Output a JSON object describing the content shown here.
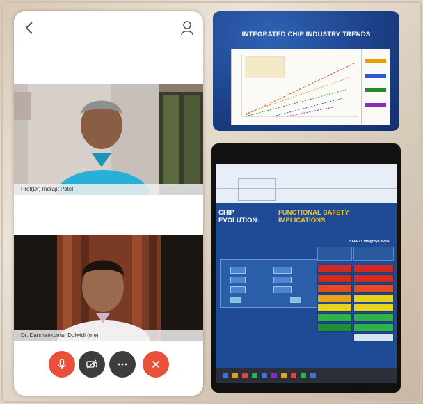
{
  "participants": [
    {
      "name": "Prof(Dr) Indrajit Patel"
    },
    {
      "name": "Dr. Darshankumar Dulwidi (me)"
    }
  ],
  "controls": {
    "mic": "microphone-button",
    "camera": "camera-button",
    "more": "more-options-button",
    "end": "end-call-button"
  },
  "slide_top": {
    "title": "INTEGRATED CHIP INDUSTRY TRENDS"
  },
  "slide_bottom": {
    "title_part1": "CHIP EVOLUTION:",
    "title_part2": "FUNCTIONAL SAFETY IMPLICATIONS",
    "table_header": "SAFETY Integrity Levels"
  },
  "colors": {
    "accent_red": "#e8503a",
    "slide_blue": "#1f4a96",
    "title_yellow": "#f4c21b"
  }
}
